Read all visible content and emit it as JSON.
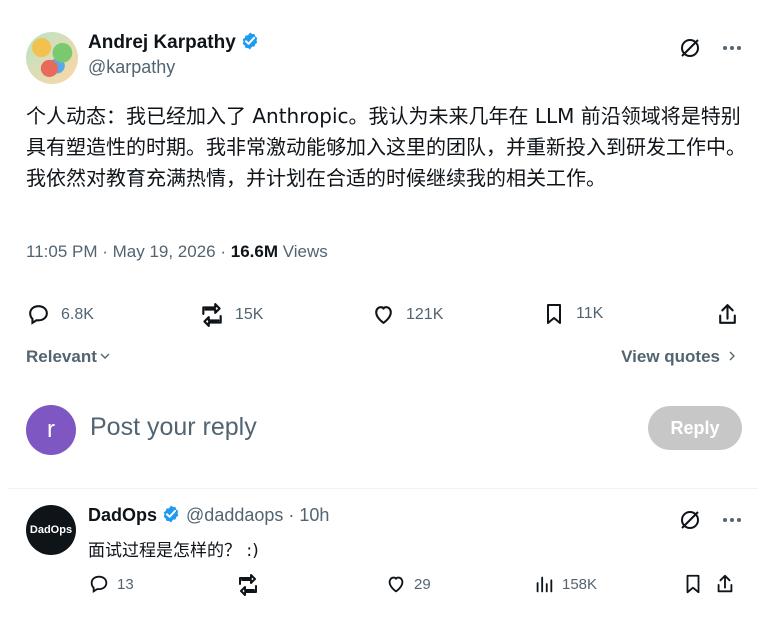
{
  "tweet": {
    "author_name": "Andrej Karpathy",
    "author_handle": "@karpathy",
    "text": "个人动态：我已经加入了 Anthropic。我认为未来几年在 LLM 前沿领域将是特别具有塑造性的时期。我非常激动能够加入这里的团队，并重新投入到研发工作中。我依然对教育充满热情，并计划在合适的时候继续我的相关工作。",
    "timestamp": "11:05 PM · May 19, 2026 · ",
    "views_count": "16.6M",
    "views_label": " Views",
    "stats": {
      "replies": "6.8K",
      "retweets": "15K",
      "likes": "121K",
      "bookmarks": "11K"
    }
  },
  "filters": {
    "relevant_label": "Relevant",
    "view_quotes_label": "View quotes"
  },
  "composer": {
    "avatar_letter": "r",
    "placeholder": "Post your reply",
    "reply_button_label": "Reply"
  },
  "reply": {
    "avatar_text": "DadOps",
    "author_name": "DadOps",
    "author_handle": "@daddaops",
    "separator": " · ",
    "time": "10h",
    "text": "面试过程是怎样的？ :)",
    "stats": {
      "replies": "13",
      "retweets": "",
      "likes": "29",
      "views": "158K"
    }
  },
  "colors": {
    "accent": "#1d9bf0",
    "muted": "#536471",
    "reply_button_disabled": "#c7c7c7",
    "composer_avatar": "#7e57c2"
  },
  "icons": {
    "verified": "verified-badge-icon",
    "grok": "grok-icon",
    "more": "more-icon",
    "reply": "reply-icon",
    "retweet": "retweet-icon",
    "like": "like-icon",
    "bookmark": "bookmark-icon",
    "share": "share-icon",
    "views": "views-icon"
  }
}
